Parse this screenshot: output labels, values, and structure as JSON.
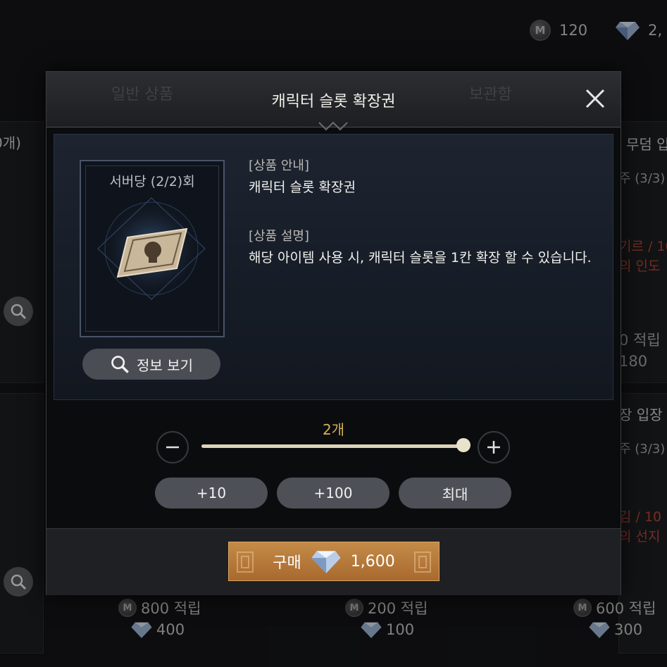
{
  "currency": {
    "mileage": "120",
    "gems": "2,"
  },
  "background": {
    "left_top_title": "0개)",
    "right_top_title": "무덤 입",
    "right_top_limit": "주 (3/3)",
    "right_top_red1": "기르 / 10",
    "right_top_red2": "의 인도",
    "right_top_points": "0 적립",
    "right_top_price": "180",
    "right_mid_title": "장 입장",
    "right_mid_limit": "주 (3/3)",
    "right_mid_red1": "김 / 10",
    "right_mid_red2": "의 선지",
    "cards_bottom": [
      {
        "points": "800 적립",
        "price": "400"
      },
      {
        "points": "200 적립",
        "price": "100"
      },
      {
        "points": "600 적립",
        "price": "300"
      }
    ],
    "tabs": [
      "일반 상품",
      "",
      "보관함"
    ]
  },
  "modal": {
    "title": "캐릭터 슬롯 확장권",
    "item_limit": "서버당  (2/2)회",
    "info_button": "정보 보기",
    "guide_label": "[상품 안내]",
    "guide_text": "캐릭터 슬롯 확장권",
    "desc_label": "[상품 설명]",
    "desc_text": "해당 아이템 사용 시, 캐릭터 슬롯을 1칸 확장 할 수 있습니다.",
    "quantity_label": "2개",
    "quantity_fraction": 1.0,
    "quick_buttons": [
      "+10",
      "+100",
      "최대"
    ],
    "buy_label": "구매",
    "buy_price": "1,600"
  },
  "colors": {
    "accent_gold": "#d7b25a",
    "buy_button": "#b97a3c"
  },
  "icons": [
    "m-coin-icon",
    "gem-icon",
    "search-icon",
    "close-icon",
    "minus-icon",
    "plus-icon"
  ]
}
